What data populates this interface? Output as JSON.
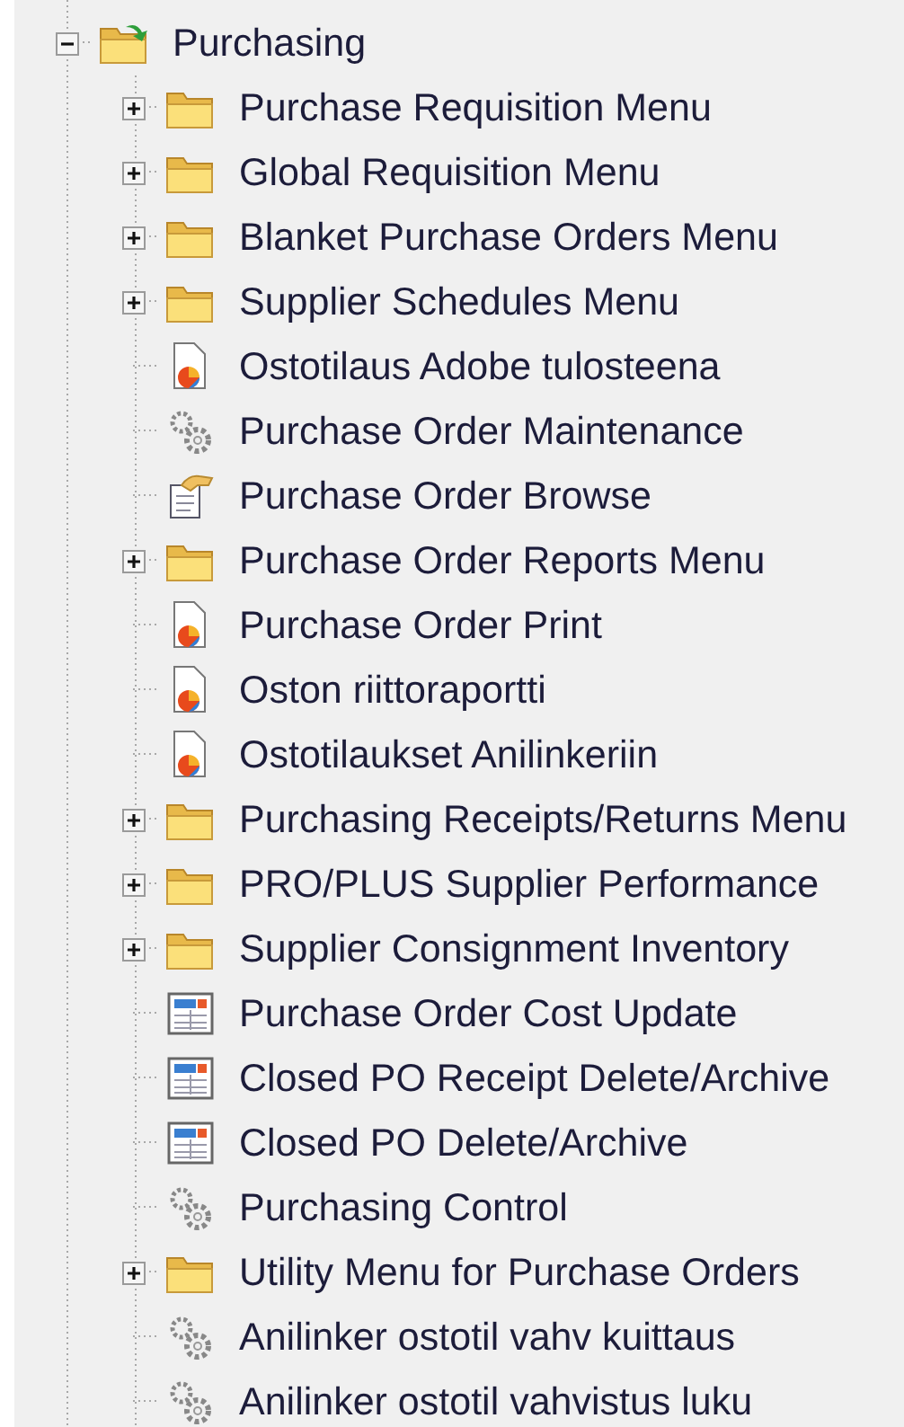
{
  "tree": [
    {
      "label": "Purchasing",
      "kind": "folder-open",
      "expanded": true,
      "children": [
        {
          "label": "Purchase Requisition Menu",
          "kind": "folder",
          "expanded": false
        },
        {
          "label": "Global Requisition Menu",
          "kind": "folder",
          "expanded": false
        },
        {
          "label": "Blanket Purchase Orders Menu",
          "kind": "folder",
          "expanded": false
        },
        {
          "label": "Supplier Schedules Menu",
          "kind": "folder",
          "expanded": false
        },
        {
          "label": "Ostotilaus Adobe tulosteena",
          "kind": "report"
        },
        {
          "label": "Purchase Order Maintenance",
          "kind": "process"
        },
        {
          "label": "Purchase Order Browse",
          "kind": "browse"
        },
        {
          "label": "Purchase Order Reports Menu",
          "kind": "folder",
          "expanded": false
        },
        {
          "label": "Purchase Order Print",
          "kind": "report"
        },
        {
          "label": "Oston riittoraportti",
          "kind": "report"
        },
        {
          "label": "Ostotilaukset Anilinkeriin",
          "kind": "report"
        },
        {
          "label": "Purchasing Receipts/Returns Menu",
          "kind": "folder",
          "expanded": false
        },
        {
          "label": "PRO/PLUS Supplier Performance",
          "kind": "folder",
          "expanded": false
        },
        {
          "label": "Supplier Consignment Inventory",
          "kind": "folder",
          "expanded": false
        },
        {
          "label": "Purchase Order Cost Update",
          "kind": "form"
        },
        {
          "label": "Closed PO Receipt Delete/Archive",
          "kind": "form"
        },
        {
          "label": "Closed PO Delete/Archive",
          "kind": "form"
        },
        {
          "label": "Purchasing Control",
          "kind": "process"
        },
        {
          "label": "Utility Menu for Purchase Orders",
          "kind": "folder",
          "expanded": false
        },
        {
          "label": "Anilinker ostotil vahv kuittaus",
          "kind": "process"
        },
        {
          "label": "Anilinker ostotil vahvistus luku",
          "kind": "process"
        }
      ]
    }
  ]
}
